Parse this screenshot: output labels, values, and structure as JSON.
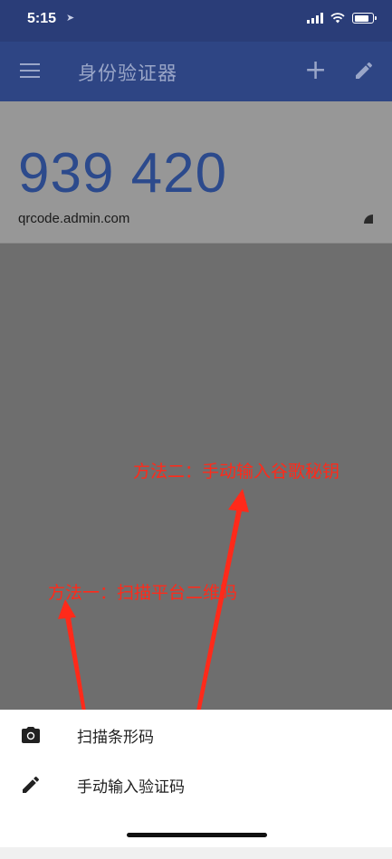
{
  "status_bar": {
    "time": "5:15",
    "location_icon": "location-arrow-icon",
    "icons": [
      "signal-icon",
      "wifi-icon",
      "battery-icon"
    ]
  },
  "app_bar": {
    "title": "身份验证器",
    "menu_icon": "menu-icon",
    "add_icon": "add-icon",
    "edit_icon": "edit-icon"
  },
  "token": {
    "code": "939 420",
    "account": "qrcode.admin.com",
    "timer_icon": "countdown-timer-icon"
  },
  "annotations": {
    "method_two": "方法二：手动输入谷歌秘钥",
    "method_one": "方法一：扫描平台二维码"
  },
  "bottom_sheet": {
    "items": [
      {
        "label": "扫描条形码",
        "icon": "camera-icon"
      },
      {
        "label": "手动输入验证码",
        "icon": "pencil-icon"
      }
    ]
  },
  "colors": {
    "app_bar": "#2e4584",
    "token_code": "#2c4a8c",
    "annotation": "#ff2a1a"
  }
}
